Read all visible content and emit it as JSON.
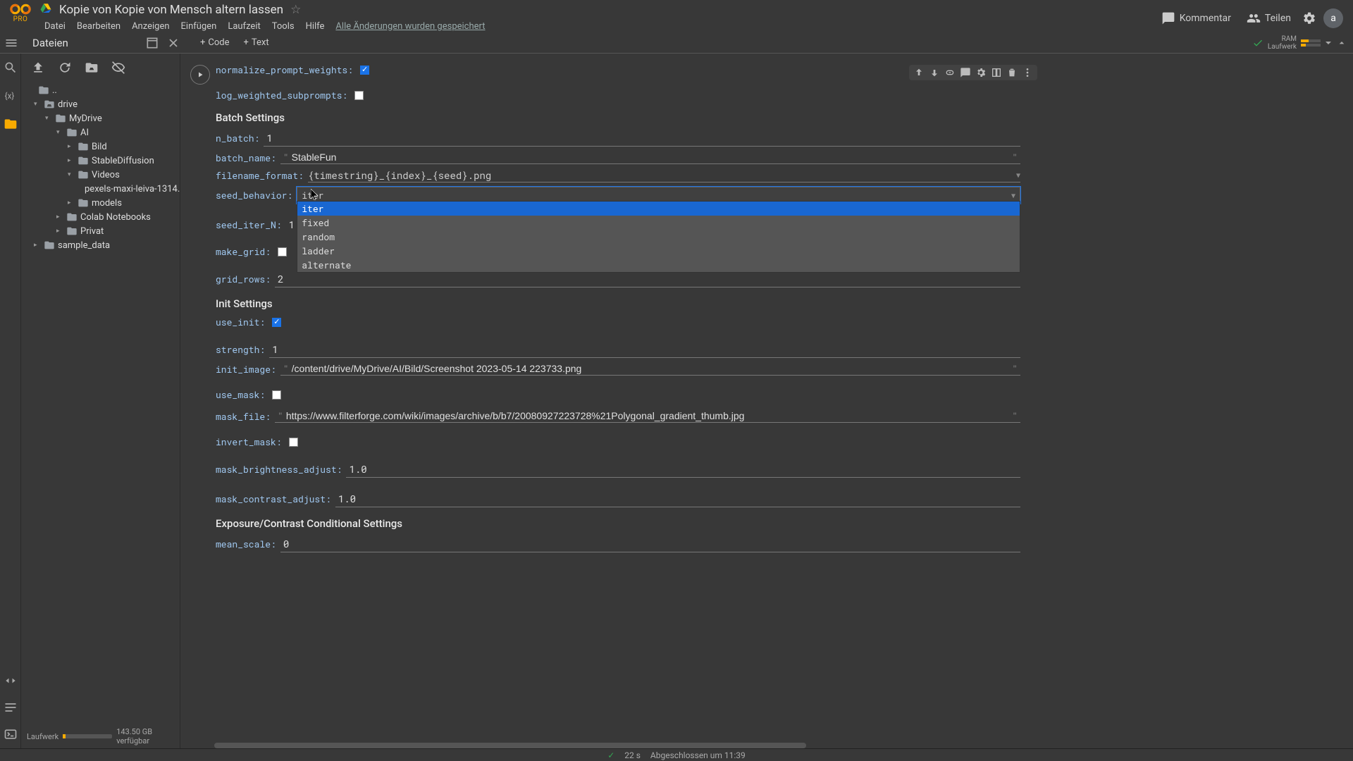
{
  "header": {
    "pro_badge": "PRO",
    "doc_title": "Kopie von Kopie von Mensch altern lassen",
    "menus": [
      "Datei",
      "Bearbeiten",
      "Anzeigen",
      "Einfügen",
      "Laufzeit",
      "Tools",
      "Hilfe"
    ],
    "save_status": "Alle Änderungen wurden gespeichert",
    "comment": "Kommentar",
    "share": "Teilen",
    "avatar": "a"
  },
  "toolbar": {
    "sidebar_title": "Dateien",
    "code_label": "Code",
    "text_label": "Text",
    "runtime_line1": "RAM",
    "runtime_line2": "Laufwerk"
  },
  "filetree": {
    "root_up": "..",
    "items": [
      {
        "depth": 0,
        "open": true,
        "type": "drive",
        "label": "drive"
      },
      {
        "depth": 1,
        "open": true,
        "type": "folder",
        "label": "MyDrive"
      },
      {
        "depth": 2,
        "open": true,
        "type": "folder",
        "label": "AI"
      },
      {
        "depth": 3,
        "open": false,
        "type": "folder",
        "label": "Bild"
      },
      {
        "depth": 3,
        "open": false,
        "type": "folder",
        "label": "StableDiffusion"
      },
      {
        "depth": 3,
        "open": true,
        "type": "folder",
        "label": "Videos"
      },
      {
        "depth": 4,
        "open": null,
        "type": "file",
        "label": "pexels-maxi-leiva-1314…"
      },
      {
        "depth": 3,
        "open": false,
        "type": "folder",
        "label": "models"
      },
      {
        "depth": 2,
        "open": false,
        "type": "folder",
        "label": "Colab Notebooks"
      },
      {
        "depth": 2,
        "open": false,
        "type": "folder",
        "label": "Privat"
      },
      {
        "depth": 0,
        "open": false,
        "type": "folder",
        "label": "sample_data"
      }
    ],
    "disk_label": "Laufwerk",
    "disk_free": "143.50 GB verfügbar"
  },
  "form": {
    "normalize_prompt_weights": {
      "label": "normalize_prompt_weights:",
      "checked": true
    },
    "log_weighted_subprompts": {
      "label": "log_weighted_subprompts:",
      "checked": false
    },
    "section_batch": "Batch Settings",
    "n_batch": {
      "label": "n_batch:",
      "value": "1"
    },
    "batch_name": {
      "label": "batch_name:",
      "value": "StableFun"
    },
    "filename_format": {
      "label": "filename_format:",
      "value": "{timestring}_{index}_{seed}.png"
    },
    "seed_behavior": {
      "label": "seed_behavior:",
      "value": "iter",
      "options": [
        "iter",
        "fixed",
        "random",
        "ladder",
        "alternate"
      ],
      "highlight": 0
    },
    "seed_iter_n": {
      "label": "seed_iter_N:",
      "value": "1"
    },
    "make_grid": {
      "label": "make_grid:",
      "checked": false
    },
    "grid_rows": {
      "label": "grid_rows:",
      "value": "2"
    },
    "section_init": "Init Settings",
    "use_init": {
      "label": "use_init:",
      "checked": true
    },
    "strength": {
      "label": "strength:",
      "value": "1"
    },
    "init_image": {
      "label": "init_image:",
      "value": "/content/drive/MyDrive/AI/Bild/Screenshot 2023-05-14 223733.png"
    },
    "use_mask": {
      "label": "use_mask:",
      "checked": false
    },
    "mask_file": {
      "label": "mask_file:",
      "value": "https://www.filterforge.com/wiki/images/archive/b/b7/20080927223728%21Polygonal_gradient_thumb.jpg"
    },
    "invert_mask": {
      "label": "invert_mask:",
      "checked": false
    },
    "mask_brightness": {
      "label": "mask_brightness_adjust:",
      "value": "1.0"
    },
    "mask_contrast": {
      "label": "mask_contrast_adjust:",
      "value": "1.0"
    },
    "section_exposure": "Exposure/Contrast Conditional Settings",
    "mean_scale": {
      "label": "mean_scale:",
      "value": "0"
    }
  },
  "status": {
    "time": "22 s",
    "msg": "Abgeschlossen um 11:39"
  }
}
